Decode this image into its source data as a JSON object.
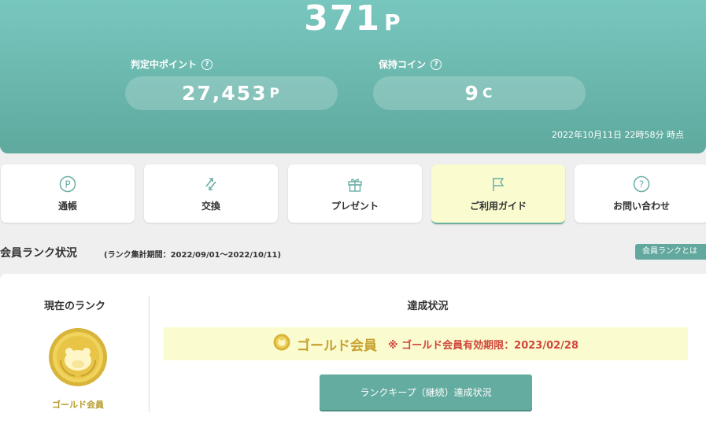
{
  "summary": {
    "total_points": "371",
    "total_points_unit": "P",
    "pending_label": "判定中ポイント",
    "pending_value": "27,453",
    "pending_unit": "P",
    "coins_label": "保持コイン",
    "coins_value": "9",
    "coins_unit": "C",
    "help_glyph": "?",
    "timestamp": "2022年10月11日 22時58分 時点"
  },
  "nav": {
    "items": [
      {
        "label": "通帳",
        "icon": "passbook-p-icon"
      },
      {
        "label": "交換",
        "icon": "exchange-icon"
      },
      {
        "label": "プレゼント",
        "icon": "gift-icon"
      },
      {
        "label": "ご利用ガイド",
        "icon": "flag-icon",
        "active": true
      },
      {
        "label": "お問い合わせ",
        "icon": "question-icon"
      }
    ]
  },
  "rank_section": {
    "title": "会員ランク状況",
    "period": "(ランク集計期間：2022/09/01～2022/10/11)",
    "info_link": "会員ランクとは",
    "current_rank_title": "現在のランク",
    "current_rank_name": "ゴールド会員",
    "achievement_title": "達成状況",
    "status_rank": "ゴールド会員",
    "status_note": "※ ゴールド会員有効期限：2023/02/28",
    "keep_button": "ランクキープ（継続）達成状況"
  },
  "colors": {
    "brand": "#62a89e",
    "gold": "#c8a12f",
    "warning": "#d0463b",
    "highlight_bg": "#fafcd0"
  }
}
